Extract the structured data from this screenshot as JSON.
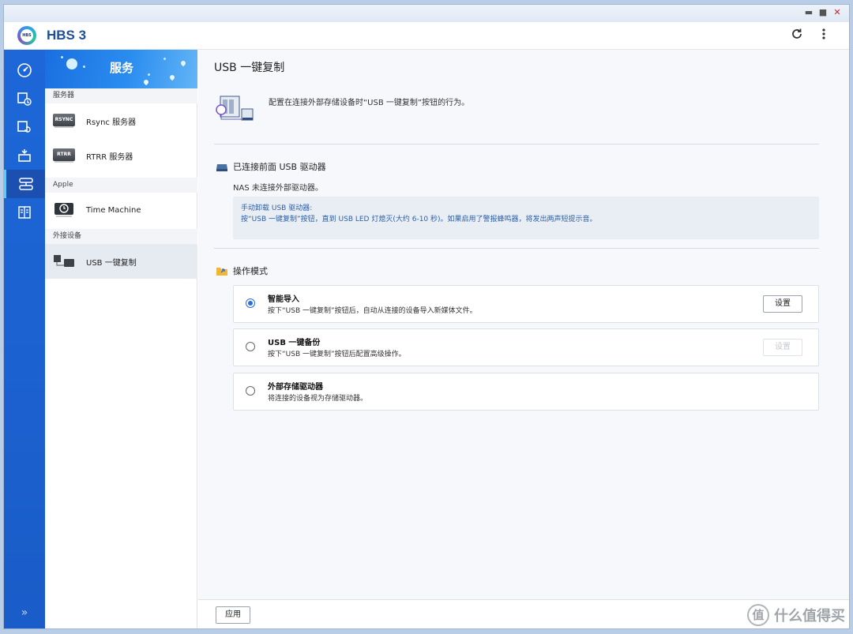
{
  "app": {
    "title": "HBS 3",
    "logo_text": "HBS"
  },
  "window_controls": {
    "minimize": "▬",
    "maximize": "■",
    "close": "✕"
  },
  "header_icons": {
    "refresh": "refresh-icon",
    "more": "more-vertical-icon"
  },
  "iconbar": {
    "items": [
      "dashboard-icon",
      "backup-icon",
      "restore-icon",
      "sync-icon",
      "services-icon",
      "logs-icon"
    ],
    "active_index": 4,
    "expand_label": "»"
  },
  "sidebar": {
    "banner_title": "服务",
    "sections": [
      {
        "label": "服务器",
        "items": [
          {
            "label": "Rsync 服务器",
            "badge": "RSYNC"
          },
          {
            "label": "RTRR 服务器",
            "badge": "RTRR"
          }
        ]
      },
      {
        "label": "Apple",
        "items": [
          {
            "label": "Time Machine"
          }
        ]
      },
      {
        "label": "外接设备",
        "items": [
          {
            "label": "USB 一键复制",
            "active": true
          }
        ]
      }
    ]
  },
  "main": {
    "title": "USB 一键复制",
    "intro": "配置在连接外部存储设备时“USB 一键复制”按钮的行为。",
    "connected_section": {
      "heading": "已连接前面 USB 驱动器",
      "status": "NAS 未连接外部驱动器。",
      "note_title": "手动卸载 USB 驱动器:",
      "note_body": "按“USB 一键复制”按钮，直到 USB LED 灯熄灭(大约 6-10 秒)。如果启用了警报蜂鸣器，将发出两声短提示音。"
    },
    "mode_section": {
      "heading": "操作模式",
      "options": [
        {
          "title": "智能导入",
          "desc": "按下“USB 一键复制”按钮后，自动从连接的设备导入新媒体文件。",
          "selected": true,
          "button": "设置",
          "button_enabled": true
        },
        {
          "title": "USB 一键备份",
          "desc": "按下“USB 一键复制”按钮后配置高级操作。",
          "selected": false,
          "button": "设置",
          "button_enabled": false
        },
        {
          "title": "外部存储驱动器",
          "desc": "将连接的设备视为存储驱动器。",
          "selected": false
        }
      ]
    }
  },
  "footer": {
    "apply_label": "应用"
  },
  "watermark": {
    "badge": "值",
    "text": "什么值得买"
  },
  "colors": {
    "accent": "#2d6bd9",
    "iconbar": "#1d67d8",
    "brand": "#1d4f99"
  }
}
